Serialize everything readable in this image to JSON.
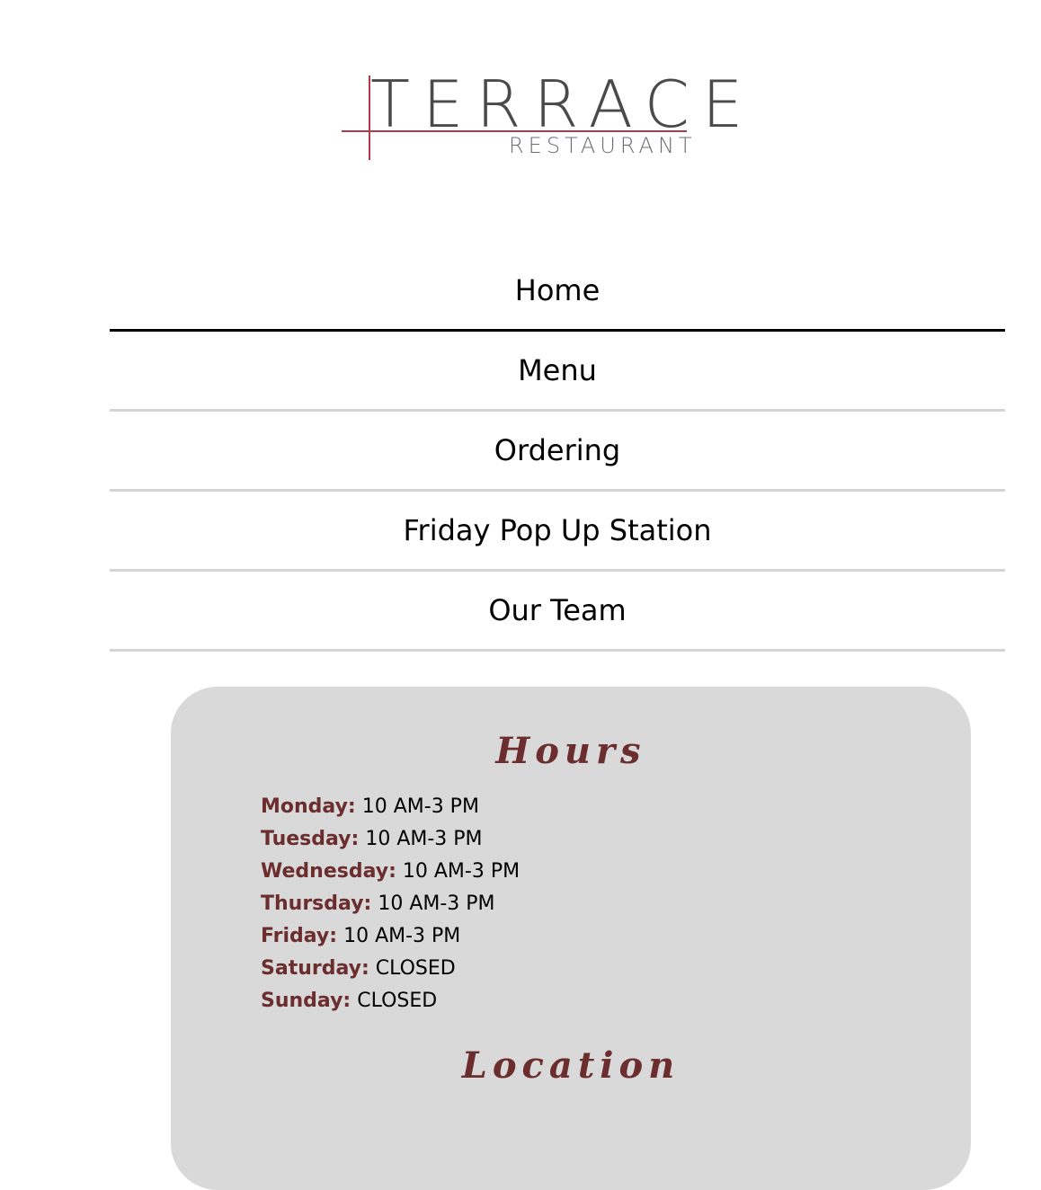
{
  "logo": {
    "title": "TERRACE",
    "subtitle": "RESTAURANT",
    "accent_color": "#b03a48",
    "text_color": "#4a4a4a"
  },
  "nav": {
    "items": [
      {
        "label": "Home",
        "active": true
      },
      {
        "label": "Menu",
        "active": false
      },
      {
        "label": "Ordering",
        "active": false
      },
      {
        "label": "Friday Pop Up Station",
        "active": false
      },
      {
        "label": "Our Team",
        "active": false
      }
    ]
  },
  "hours": {
    "title": "Hours",
    "rows": [
      {
        "day": "Monday:",
        "time": "10 AM-3 PM"
      },
      {
        "day": "Tuesday:",
        "time": "10 AM-3 PM"
      },
      {
        "day": "Wednesday:",
        "time": "10 AM-3 PM"
      },
      {
        "day": "Thursday:",
        "time": "10 AM-3 PM"
      },
      {
        "day": "Friday:",
        "time": "10 AM-3 PM"
      },
      {
        "day": "Saturday:",
        "time": "CLOSED"
      },
      {
        "day": "Sunday:",
        "time": "CLOSED"
      }
    ]
  },
  "location": {
    "title": "Location"
  },
  "colors": {
    "heading": "#6b2d2d",
    "card_background": "#d9d9d9",
    "nav_divider": "#d4d4d4",
    "nav_active_divider": "#000000"
  }
}
